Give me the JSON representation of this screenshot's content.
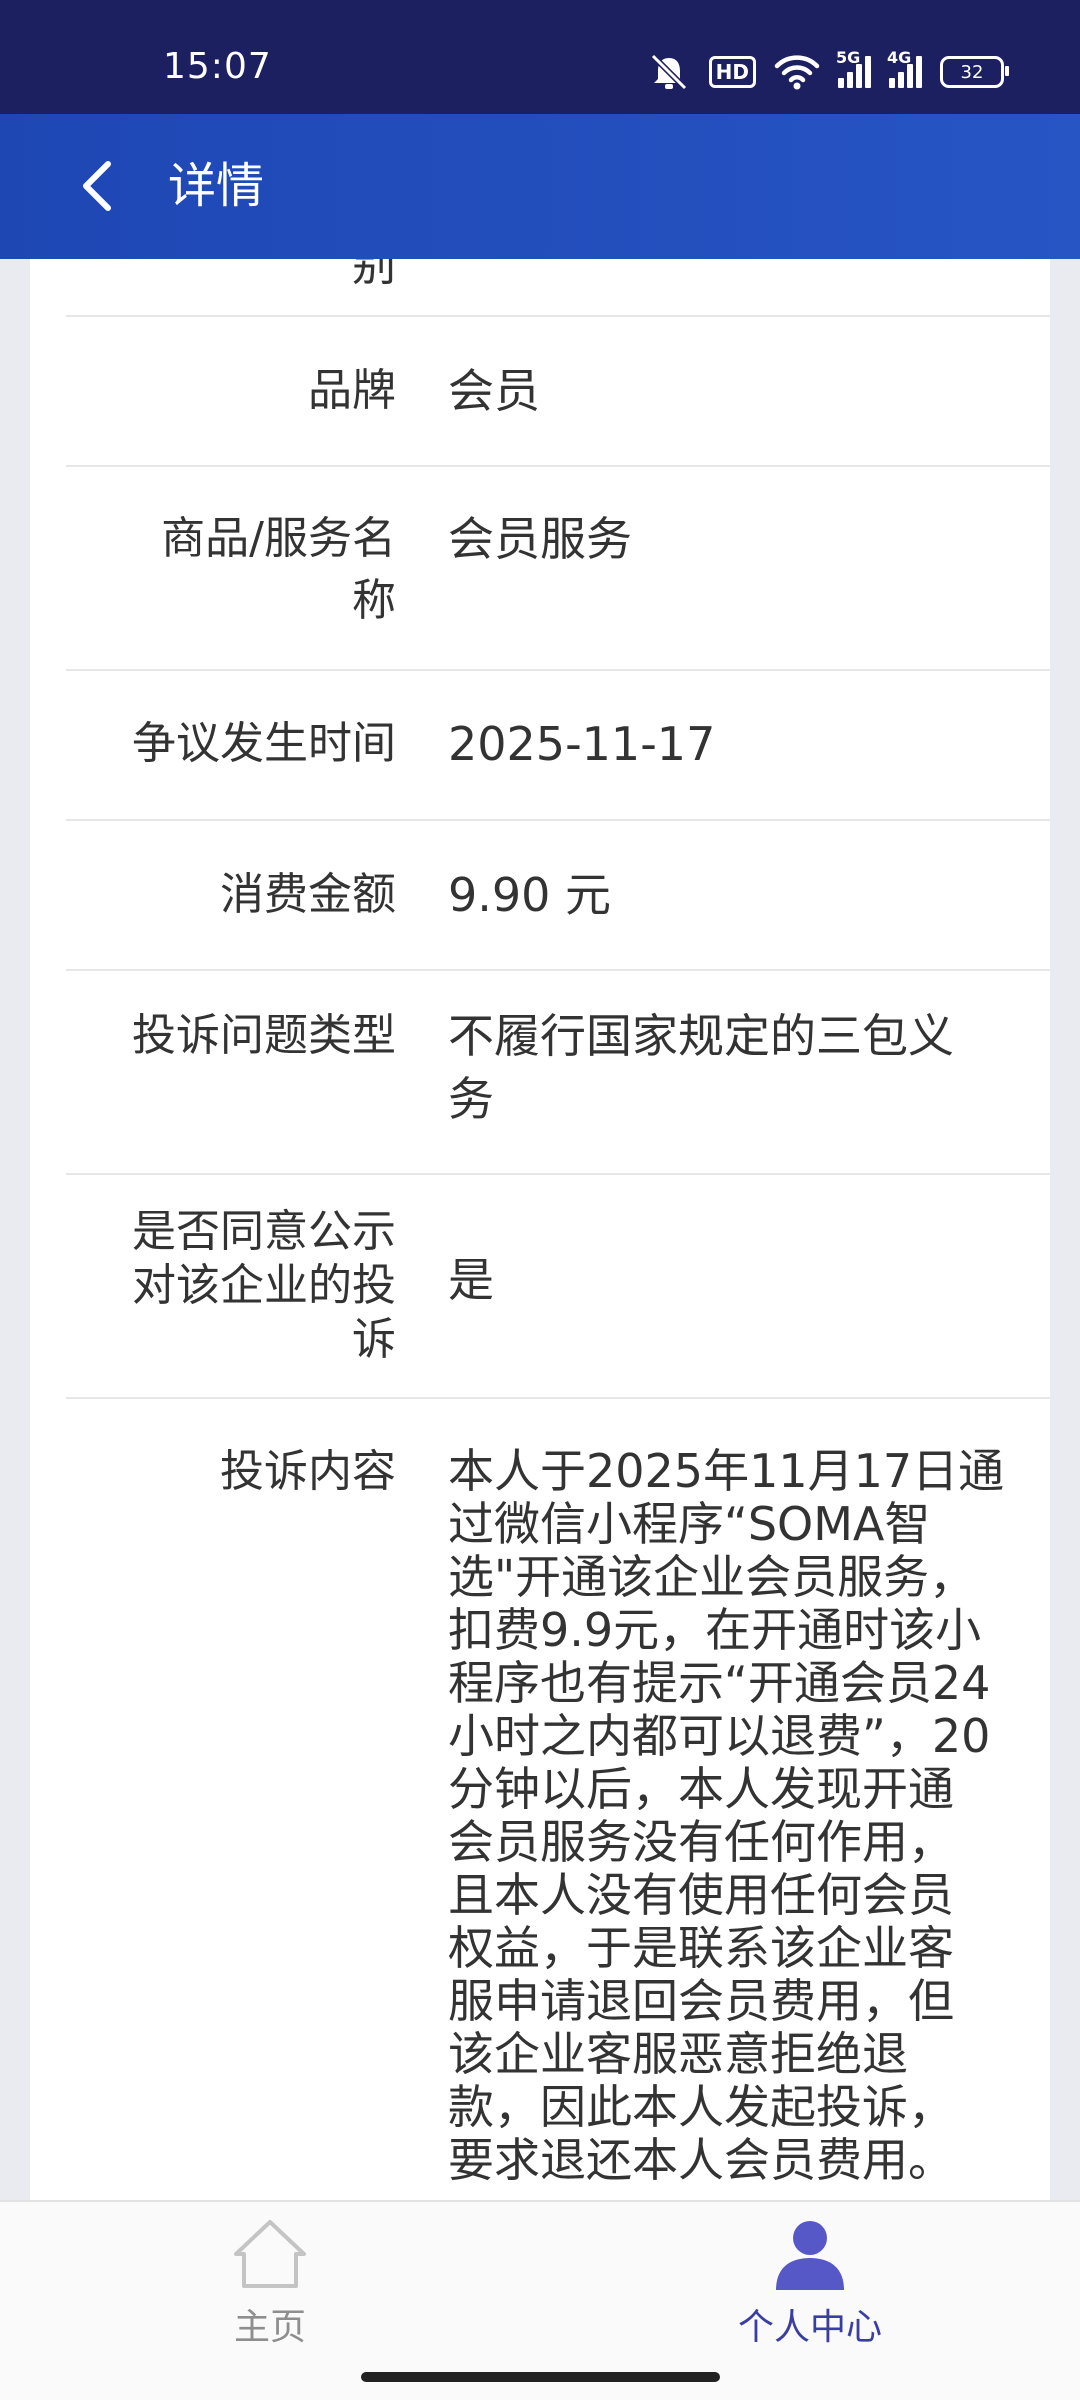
{
  "status_bar": {
    "time": "15:07",
    "hd": "HD",
    "net1": "5G",
    "net2": "4G",
    "battery": "32",
    "icons": [
      "mute-icon",
      "wifi-icon",
      "signal-icon",
      "battery-icon"
    ]
  },
  "header": {
    "title": "详情",
    "back_icon": "chevron-left-icon"
  },
  "details": {
    "top_fragment": "别",
    "brand": {
      "label": "品牌",
      "value": "会员"
    },
    "product": {
      "label_1": "商品/服务名",
      "label_2": "称",
      "value": "会员服务"
    },
    "dispute_time": {
      "label": "争议发生时间",
      "value": "2025-11-17"
    },
    "amount": {
      "label": "消费金额",
      "value": "9.90 元"
    },
    "issue_type": {
      "label": "投诉问题类型",
      "value_1": "不履行国家规定的三包义",
      "value_2": "务"
    },
    "publish": {
      "label_1": "是否同意公示",
      "label_2": "对该企业的投",
      "label_3": "诉",
      "value": "是"
    },
    "content": {
      "label": "投诉内容",
      "lines": [
        "本人于2025年11月17日通",
        "过微信小程序“SOMA智",
        "选\"开通该企业会员服务，",
        "扣费9.9元，在开通时该小",
        "程序也有提示“开通会员24",
        "小时之内都可以退费”，20",
        "分钟以后，本人发现开通",
        "会员服务没有任何作用，",
        "且本人没有使用任何会员",
        "权益，于是联系该企业客",
        "服申请退回会员费用，但",
        "该企业客服恶意拒绝退",
        "款，因此本人发起投诉，",
        "要求退还本人会员费用。"
      ]
    }
  },
  "bottom_nav": {
    "home": "主页",
    "me": "个人中心"
  },
  "colors": {
    "status_bar": "#1d2060",
    "header": "#2450bf",
    "active_tab": "#3a3ea4",
    "inactive_tab": "#8e8e8e"
  }
}
